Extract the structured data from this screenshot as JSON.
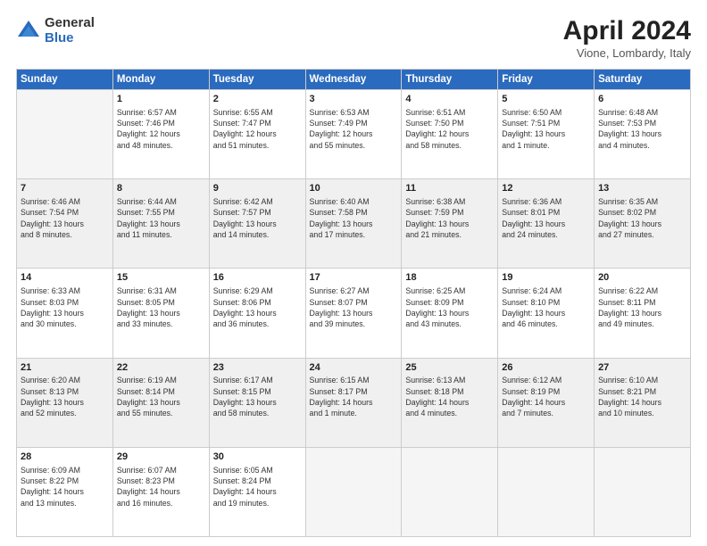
{
  "logo": {
    "general": "General",
    "blue": "Blue"
  },
  "title": {
    "month": "April 2024",
    "location": "Vione, Lombardy, Italy"
  },
  "weekdays": [
    "Sunday",
    "Monday",
    "Tuesday",
    "Wednesday",
    "Thursday",
    "Friday",
    "Saturday"
  ],
  "weeks": [
    [
      {
        "day": "",
        "info": ""
      },
      {
        "day": "1",
        "info": "Sunrise: 6:57 AM\nSunset: 7:46 PM\nDaylight: 12 hours\nand 48 minutes."
      },
      {
        "day": "2",
        "info": "Sunrise: 6:55 AM\nSunset: 7:47 PM\nDaylight: 12 hours\nand 51 minutes."
      },
      {
        "day": "3",
        "info": "Sunrise: 6:53 AM\nSunset: 7:49 PM\nDaylight: 12 hours\nand 55 minutes."
      },
      {
        "day": "4",
        "info": "Sunrise: 6:51 AM\nSunset: 7:50 PM\nDaylight: 12 hours\nand 58 minutes."
      },
      {
        "day": "5",
        "info": "Sunrise: 6:50 AM\nSunset: 7:51 PM\nDaylight: 13 hours\nand 1 minute."
      },
      {
        "day": "6",
        "info": "Sunrise: 6:48 AM\nSunset: 7:53 PM\nDaylight: 13 hours\nand 4 minutes."
      }
    ],
    [
      {
        "day": "7",
        "info": "Sunrise: 6:46 AM\nSunset: 7:54 PM\nDaylight: 13 hours\nand 8 minutes."
      },
      {
        "day": "8",
        "info": "Sunrise: 6:44 AM\nSunset: 7:55 PM\nDaylight: 13 hours\nand 11 minutes."
      },
      {
        "day": "9",
        "info": "Sunrise: 6:42 AM\nSunset: 7:57 PM\nDaylight: 13 hours\nand 14 minutes."
      },
      {
        "day": "10",
        "info": "Sunrise: 6:40 AM\nSunset: 7:58 PM\nDaylight: 13 hours\nand 17 minutes."
      },
      {
        "day": "11",
        "info": "Sunrise: 6:38 AM\nSunset: 7:59 PM\nDaylight: 13 hours\nand 21 minutes."
      },
      {
        "day": "12",
        "info": "Sunrise: 6:36 AM\nSunset: 8:01 PM\nDaylight: 13 hours\nand 24 minutes."
      },
      {
        "day": "13",
        "info": "Sunrise: 6:35 AM\nSunset: 8:02 PM\nDaylight: 13 hours\nand 27 minutes."
      }
    ],
    [
      {
        "day": "14",
        "info": "Sunrise: 6:33 AM\nSunset: 8:03 PM\nDaylight: 13 hours\nand 30 minutes."
      },
      {
        "day": "15",
        "info": "Sunrise: 6:31 AM\nSunset: 8:05 PM\nDaylight: 13 hours\nand 33 minutes."
      },
      {
        "day": "16",
        "info": "Sunrise: 6:29 AM\nSunset: 8:06 PM\nDaylight: 13 hours\nand 36 minutes."
      },
      {
        "day": "17",
        "info": "Sunrise: 6:27 AM\nSunset: 8:07 PM\nDaylight: 13 hours\nand 39 minutes."
      },
      {
        "day": "18",
        "info": "Sunrise: 6:25 AM\nSunset: 8:09 PM\nDaylight: 13 hours\nand 43 minutes."
      },
      {
        "day": "19",
        "info": "Sunrise: 6:24 AM\nSunset: 8:10 PM\nDaylight: 13 hours\nand 46 minutes."
      },
      {
        "day": "20",
        "info": "Sunrise: 6:22 AM\nSunset: 8:11 PM\nDaylight: 13 hours\nand 49 minutes."
      }
    ],
    [
      {
        "day": "21",
        "info": "Sunrise: 6:20 AM\nSunset: 8:13 PM\nDaylight: 13 hours\nand 52 minutes."
      },
      {
        "day": "22",
        "info": "Sunrise: 6:19 AM\nSunset: 8:14 PM\nDaylight: 13 hours\nand 55 minutes."
      },
      {
        "day": "23",
        "info": "Sunrise: 6:17 AM\nSunset: 8:15 PM\nDaylight: 13 hours\nand 58 minutes."
      },
      {
        "day": "24",
        "info": "Sunrise: 6:15 AM\nSunset: 8:17 PM\nDaylight: 14 hours\nand 1 minute."
      },
      {
        "day": "25",
        "info": "Sunrise: 6:13 AM\nSunset: 8:18 PM\nDaylight: 14 hours\nand 4 minutes."
      },
      {
        "day": "26",
        "info": "Sunrise: 6:12 AM\nSunset: 8:19 PM\nDaylight: 14 hours\nand 7 minutes."
      },
      {
        "day": "27",
        "info": "Sunrise: 6:10 AM\nSunset: 8:21 PM\nDaylight: 14 hours\nand 10 minutes."
      }
    ],
    [
      {
        "day": "28",
        "info": "Sunrise: 6:09 AM\nSunset: 8:22 PM\nDaylight: 14 hours\nand 13 minutes."
      },
      {
        "day": "29",
        "info": "Sunrise: 6:07 AM\nSunset: 8:23 PM\nDaylight: 14 hours\nand 16 minutes."
      },
      {
        "day": "30",
        "info": "Sunrise: 6:05 AM\nSunset: 8:24 PM\nDaylight: 14 hours\nand 19 minutes."
      },
      {
        "day": "",
        "info": ""
      },
      {
        "day": "",
        "info": ""
      },
      {
        "day": "",
        "info": ""
      },
      {
        "day": "",
        "info": ""
      }
    ]
  ]
}
